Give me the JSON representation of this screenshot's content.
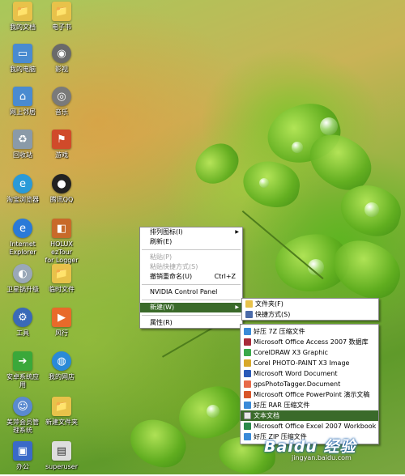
{
  "desktop_icons": [
    {
      "label": "我的文档",
      "icon": "folder-documents-icon",
      "color": "#e8c24a"
    },
    {
      "label": "电子书",
      "icon": "folder-icon",
      "color": "#e8c24a"
    },
    {
      "label": "我的电脑",
      "icon": "computer-icon",
      "color": "#4a8bd0"
    },
    {
      "label": "影视",
      "icon": "dvd-icon",
      "color": "#6a6a6a"
    },
    {
      "label": "网上邻居",
      "icon": "network-icon",
      "color": "#4a8bd0"
    },
    {
      "label": "音乐",
      "icon": "cd-icon",
      "color": "#7a7a7a"
    },
    {
      "label": "回收站",
      "icon": "recycle-bin-icon",
      "color": "#8a9aa8"
    },
    {
      "label": "游戏",
      "icon": "game-flag-icon",
      "color": "#d04a2a"
    },
    {
      "label": "淘宝浏览器",
      "icon": "taobao-browser-icon",
      "color": "#2a9ad8"
    },
    {
      "label": "腾讯QQ",
      "icon": "qq-penguin-icon",
      "color": "#222222"
    },
    {
      "label": "Internet\nExplorer",
      "icon": "ie-icon",
      "color": "#2a7ad8"
    },
    {
      "label": "HOLUX ezTour\nfor Logger",
      "icon": "holux-icon",
      "color": "#c86a2a"
    },
    {
      "label": "卫星锅升级",
      "icon": "satellite-icon",
      "color": "#9aa8b8"
    },
    {
      "label": "临时文件",
      "icon": "folder-icon",
      "color": "#e8c24a"
    },
    {
      "label": "工具",
      "icon": "tools-icon",
      "color": "#3a6ab8"
    },
    {
      "label": "风行",
      "icon": "funshion-icon",
      "color": "#e86a2a"
    },
    {
      "label": "安卓系统应\n用",
      "icon": "green-arrow-icon",
      "color": "#3aa83a"
    },
    {
      "label": "我的网店",
      "icon": "globe-icon",
      "color": "#2a8ad8"
    },
    {
      "label": "美萍会员管\n理系统",
      "icon": "user-icon",
      "color": "#5a8ad0"
    },
    {
      "label": "新建文件夹",
      "icon": "folder-icon",
      "color": "#e8c24a"
    },
    {
      "label": "办公",
      "icon": "office-icon",
      "color": "#3a6ac8"
    },
    {
      "label": "superuser",
      "icon": "document-icon",
      "color": "#dddddd"
    }
  ],
  "context_menu": {
    "items": [
      {
        "label": "排列图标(I)",
        "submenu": true,
        "disabled": false
      },
      {
        "label": "刷新(E)",
        "disabled": false
      },
      {
        "separator": true
      },
      {
        "label": "粘贴(P)",
        "disabled": true
      },
      {
        "label": "粘贴快捷方式(S)",
        "disabled": true
      },
      {
        "label": "撤销重命名(U)",
        "shortcut": "Ctrl+Z",
        "disabled": false
      },
      {
        "separator": true
      },
      {
        "label": "NVIDIA Control Panel",
        "disabled": false
      },
      {
        "separator": true
      },
      {
        "label": "新建(W)",
        "submenu": true,
        "highlighted": true
      },
      {
        "separator": true
      },
      {
        "label": "属性(R)",
        "disabled": false
      }
    ]
  },
  "new_submenu": {
    "items": [
      {
        "label": "文件夹(F)",
        "icon": "folder-icon",
        "color": "#e8c24a"
      },
      {
        "label": "快捷方式(S)",
        "icon": "shortcut-icon",
        "color": "#4a6aa8"
      }
    ],
    "file_types": [
      {
        "label": "好压 7Z 压缩文件",
        "icon": "haozip-7z-icon",
        "color": "#3a8ad8"
      },
      {
        "label": "Microsoft Office Access 2007 数据库",
        "icon": "access-icon",
        "color": "#a82a3a"
      },
      {
        "label": "CorelDRAW X3 Graphic",
        "icon": "coreldraw-icon",
        "color": "#3aa84a"
      },
      {
        "label": "Corel PHOTO-PAINT X3 Image",
        "icon": "photopaint-icon",
        "color": "#d8a82a"
      },
      {
        "label": "Microsoft Word Document",
        "icon": "word-icon",
        "color": "#2a5ab8"
      },
      {
        "label": "gpsPhotoTagger.Document",
        "icon": "gps-document-icon",
        "color": "#e86a4a"
      },
      {
        "label": "Microsoft Office PowerPoint 演示文稿",
        "icon": "powerpoint-icon",
        "color": "#d8562a"
      },
      {
        "label": "好压 RAR 压缩文件",
        "icon": "haozip-rar-icon",
        "color": "#3a8ad8"
      },
      {
        "label": "文本文档",
        "icon": "text-document-icon",
        "color": "#e8e8e8",
        "highlighted": true
      },
      {
        "label": "Microsoft Office Excel 2007 Workbook",
        "icon": "excel-icon",
        "color": "#2a8a4a"
      },
      {
        "label": "好压 ZIP 压缩文件",
        "icon": "haozip-zip-icon",
        "color": "#3a8ad8"
      }
    ]
  },
  "watermark": {
    "logo": "Baidu 经验",
    "url": "jingyan.baidu.com"
  },
  "colors": {
    "menu_highlight": "#316ac5",
    "submenu_highlight": "#3a6a2a"
  }
}
